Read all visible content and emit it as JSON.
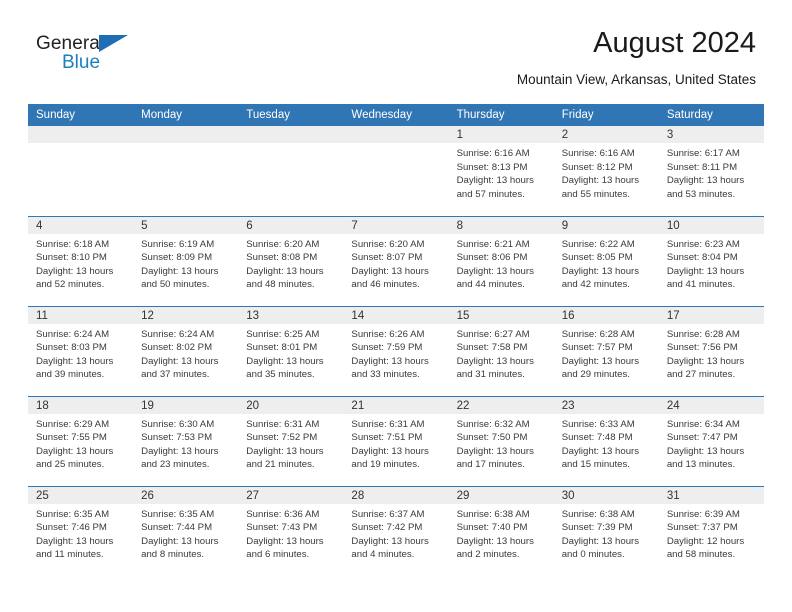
{
  "brand": {
    "line1": "General",
    "line2": "Blue",
    "triangle_icon": "triangle-logo-icon",
    "colors": {
      "dark": "#231f20",
      "blue": "#1a7fc1",
      "triangle": "#1f6db5"
    }
  },
  "header": {
    "month_title": "August 2024",
    "location": "Mountain View, Arkansas, United States"
  },
  "theme": {
    "header_blue": "#3075b4",
    "daynum_band": "#eeeeee",
    "text": "#3a3a3a"
  },
  "calendar": {
    "weekday_headers": [
      "Sunday",
      "Monday",
      "Tuesday",
      "Wednesday",
      "Thursday",
      "Friday",
      "Saturday"
    ],
    "labels": {
      "sunrise": "Sunrise:",
      "sunset": "Sunset:",
      "daylight": "Daylight:"
    },
    "weeks": [
      [
        {
          "day": "",
          "empty": true
        },
        {
          "day": "",
          "empty": true
        },
        {
          "day": "",
          "empty": true
        },
        {
          "day": "",
          "empty": true
        },
        {
          "day": "1",
          "sunrise": "Sunrise: 6:16 AM",
          "sunset": "Sunset: 8:13 PM",
          "daylight_l1": "Daylight: 13 hours",
          "daylight_l2": "and 57 minutes."
        },
        {
          "day": "2",
          "sunrise": "Sunrise: 6:16 AM",
          "sunset": "Sunset: 8:12 PM",
          "daylight_l1": "Daylight: 13 hours",
          "daylight_l2": "and 55 minutes."
        },
        {
          "day": "3",
          "sunrise": "Sunrise: 6:17 AM",
          "sunset": "Sunset: 8:11 PM",
          "daylight_l1": "Daylight: 13 hours",
          "daylight_l2": "and 53 minutes."
        }
      ],
      [
        {
          "day": "4",
          "sunrise": "Sunrise: 6:18 AM",
          "sunset": "Sunset: 8:10 PM",
          "daylight_l1": "Daylight: 13 hours",
          "daylight_l2": "and 52 minutes."
        },
        {
          "day": "5",
          "sunrise": "Sunrise: 6:19 AM",
          "sunset": "Sunset: 8:09 PM",
          "daylight_l1": "Daylight: 13 hours",
          "daylight_l2": "and 50 minutes."
        },
        {
          "day": "6",
          "sunrise": "Sunrise: 6:20 AM",
          "sunset": "Sunset: 8:08 PM",
          "daylight_l1": "Daylight: 13 hours",
          "daylight_l2": "and 48 minutes."
        },
        {
          "day": "7",
          "sunrise": "Sunrise: 6:20 AM",
          "sunset": "Sunset: 8:07 PM",
          "daylight_l1": "Daylight: 13 hours",
          "daylight_l2": "and 46 minutes."
        },
        {
          "day": "8",
          "sunrise": "Sunrise: 6:21 AM",
          "sunset": "Sunset: 8:06 PM",
          "daylight_l1": "Daylight: 13 hours",
          "daylight_l2": "and 44 minutes."
        },
        {
          "day": "9",
          "sunrise": "Sunrise: 6:22 AM",
          "sunset": "Sunset: 8:05 PM",
          "daylight_l1": "Daylight: 13 hours",
          "daylight_l2": "and 42 minutes."
        },
        {
          "day": "10",
          "sunrise": "Sunrise: 6:23 AM",
          "sunset": "Sunset: 8:04 PM",
          "daylight_l1": "Daylight: 13 hours",
          "daylight_l2": "and 41 minutes."
        }
      ],
      [
        {
          "day": "11",
          "sunrise": "Sunrise: 6:24 AM",
          "sunset": "Sunset: 8:03 PM",
          "daylight_l1": "Daylight: 13 hours",
          "daylight_l2": "and 39 minutes."
        },
        {
          "day": "12",
          "sunrise": "Sunrise: 6:24 AM",
          "sunset": "Sunset: 8:02 PM",
          "daylight_l1": "Daylight: 13 hours",
          "daylight_l2": "and 37 minutes."
        },
        {
          "day": "13",
          "sunrise": "Sunrise: 6:25 AM",
          "sunset": "Sunset: 8:01 PM",
          "daylight_l1": "Daylight: 13 hours",
          "daylight_l2": "and 35 minutes."
        },
        {
          "day": "14",
          "sunrise": "Sunrise: 6:26 AM",
          "sunset": "Sunset: 7:59 PM",
          "daylight_l1": "Daylight: 13 hours",
          "daylight_l2": "and 33 minutes."
        },
        {
          "day": "15",
          "sunrise": "Sunrise: 6:27 AM",
          "sunset": "Sunset: 7:58 PM",
          "daylight_l1": "Daylight: 13 hours",
          "daylight_l2": "and 31 minutes."
        },
        {
          "day": "16",
          "sunrise": "Sunrise: 6:28 AM",
          "sunset": "Sunset: 7:57 PM",
          "daylight_l1": "Daylight: 13 hours",
          "daylight_l2": "and 29 minutes."
        },
        {
          "day": "17",
          "sunrise": "Sunrise: 6:28 AM",
          "sunset": "Sunset: 7:56 PM",
          "daylight_l1": "Daylight: 13 hours",
          "daylight_l2": "and 27 minutes."
        }
      ],
      [
        {
          "day": "18",
          "sunrise": "Sunrise: 6:29 AM",
          "sunset": "Sunset: 7:55 PM",
          "daylight_l1": "Daylight: 13 hours",
          "daylight_l2": "and 25 minutes."
        },
        {
          "day": "19",
          "sunrise": "Sunrise: 6:30 AM",
          "sunset": "Sunset: 7:53 PM",
          "daylight_l1": "Daylight: 13 hours",
          "daylight_l2": "and 23 minutes."
        },
        {
          "day": "20",
          "sunrise": "Sunrise: 6:31 AM",
          "sunset": "Sunset: 7:52 PM",
          "daylight_l1": "Daylight: 13 hours",
          "daylight_l2": "and 21 minutes."
        },
        {
          "day": "21",
          "sunrise": "Sunrise: 6:31 AM",
          "sunset": "Sunset: 7:51 PM",
          "daylight_l1": "Daylight: 13 hours",
          "daylight_l2": "and 19 minutes."
        },
        {
          "day": "22",
          "sunrise": "Sunrise: 6:32 AM",
          "sunset": "Sunset: 7:50 PM",
          "daylight_l1": "Daylight: 13 hours",
          "daylight_l2": "and 17 minutes."
        },
        {
          "day": "23",
          "sunrise": "Sunrise: 6:33 AM",
          "sunset": "Sunset: 7:48 PM",
          "daylight_l1": "Daylight: 13 hours",
          "daylight_l2": "and 15 minutes."
        },
        {
          "day": "24",
          "sunrise": "Sunrise: 6:34 AM",
          "sunset": "Sunset: 7:47 PM",
          "daylight_l1": "Daylight: 13 hours",
          "daylight_l2": "and 13 minutes."
        }
      ],
      [
        {
          "day": "25",
          "sunrise": "Sunrise: 6:35 AM",
          "sunset": "Sunset: 7:46 PM",
          "daylight_l1": "Daylight: 13 hours",
          "daylight_l2": "and 11 minutes."
        },
        {
          "day": "26",
          "sunrise": "Sunrise: 6:35 AM",
          "sunset": "Sunset: 7:44 PM",
          "daylight_l1": "Daylight: 13 hours",
          "daylight_l2": "and 8 minutes."
        },
        {
          "day": "27",
          "sunrise": "Sunrise: 6:36 AM",
          "sunset": "Sunset: 7:43 PM",
          "daylight_l1": "Daylight: 13 hours",
          "daylight_l2": "and 6 minutes."
        },
        {
          "day": "28",
          "sunrise": "Sunrise: 6:37 AM",
          "sunset": "Sunset: 7:42 PM",
          "daylight_l1": "Daylight: 13 hours",
          "daylight_l2": "and 4 minutes."
        },
        {
          "day": "29",
          "sunrise": "Sunrise: 6:38 AM",
          "sunset": "Sunset: 7:40 PM",
          "daylight_l1": "Daylight: 13 hours",
          "daylight_l2": "and 2 minutes."
        },
        {
          "day": "30",
          "sunrise": "Sunrise: 6:38 AM",
          "sunset": "Sunset: 7:39 PM",
          "daylight_l1": "Daylight: 13 hours",
          "daylight_l2": "and 0 minutes."
        },
        {
          "day": "31",
          "sunrise": "Sunrise: 6:39 AM",
          "sunset": "Sunset: 7:37 PM",
          "daylight_l1": "Daylight: 12 hours",
          "daylight_l2": "and 58 minutes."
        }
      ]
    ]
  }
}
